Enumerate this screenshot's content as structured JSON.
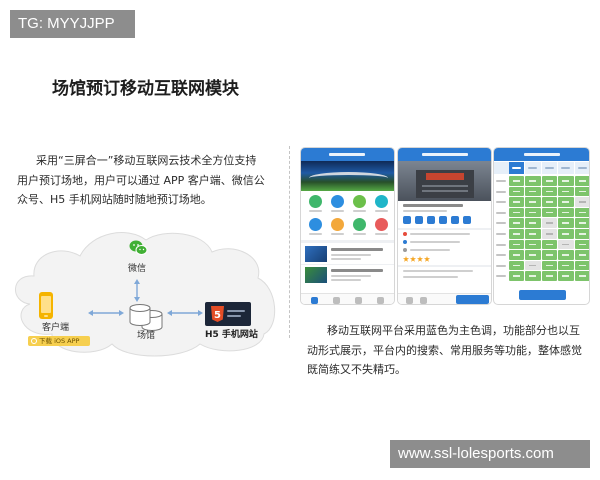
{
  "watermarks": {
    "top_left": "TG: MYYJJPP",
    "bottom_right": "www.ssl-lolesports.com"
  },
  "title": "场馆预订移动互联网模块",
  "intro_lines": [
    "采用“三屏合一”移动互联网云技术全方位支持",
    "用户预订场地，用户可以通过 APP 客户端、微信公",
    "众号、H5 手机网站随时随地预订场地。"
  ],
  "diagram": {
    "wechat_label": "微信",
    "client_label": "客户端",
    "client_badge": "下载 iOS APP",
    "venue_label": "场馆",
    "h5_label": "H5 手机网站",
    "h5_logo_text": "5",
    "icons": [
      "wechat-icon",
      "phone-icon",
      "database-icon",
      "html5-icon"
    ]
  },
  "description_lines": [
    "移动互联网平台采用蓝色为主色调，功能部分也以互",
    "动形式展示，平台内的搜索、常用服务等功能，整体感觉",
    "既简练又不失精巧。"
  ],
  "colors": {
    "brand_blue": "#2c7bd3",
    "slot_green": "#7dc46b",
    "wechat_green": "#41b035",
    "h5_orange": "#e44d26",
    "client_yellow": "#f5b400",
    "cloud_fill": "#f3f3f3",
    "arrow_blue": "#7fa8d8"
  }
}
